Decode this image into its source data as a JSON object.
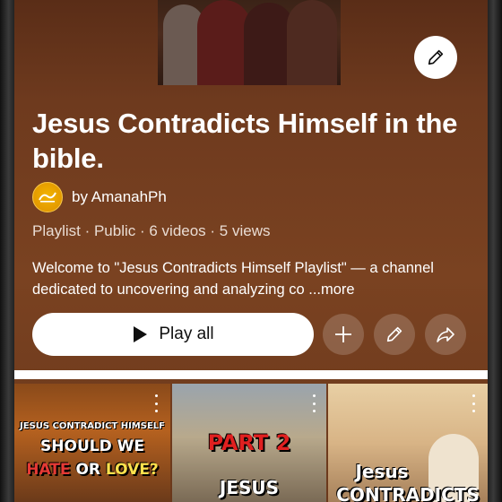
{
  "playlist": {
    "title": "Jesus Contradicts Himself in the bible.",
    "channel": {
      "name": "by AmanahPh",
      "avatar_icon": "amanah-logo-icon",
      "avatar_color": "#f2b400"
    },
    "meta": "Playlist · Public · 6 videos · 5 views",
    "description": {
      "text": "Welcome to \"Jesus Contradicts Himself Playlist\" — a channel dedicated to uncovering and analyzing co",
      "more": "...more"
    }
  },
  "actions": {
    "play_all": "Play all",
    "play_icon": "play-icon",
    "add_icon": "plus-icon",
    "edit_icon": "pencil-icon",
    "share_icon": "share-icon"
  },
  "colors": {
    "background": "#7a4221",
    "button_bg": "#ffffff"
  },
  "videos": [
    {
      "small_text": "JESUS CONTRADICT HIMSELF",
      "big_text": "SHOULD WE",
      "hate": "HATE",
      "or": "OR",
      "love": "LOVE?"
    },
    {
      "part": "PART 2",
      "jesus": "JESUS"
    },
    {
      "jesus": "Jesus",
      "contra": "CONTRADICTS"
    }
  ]
}
